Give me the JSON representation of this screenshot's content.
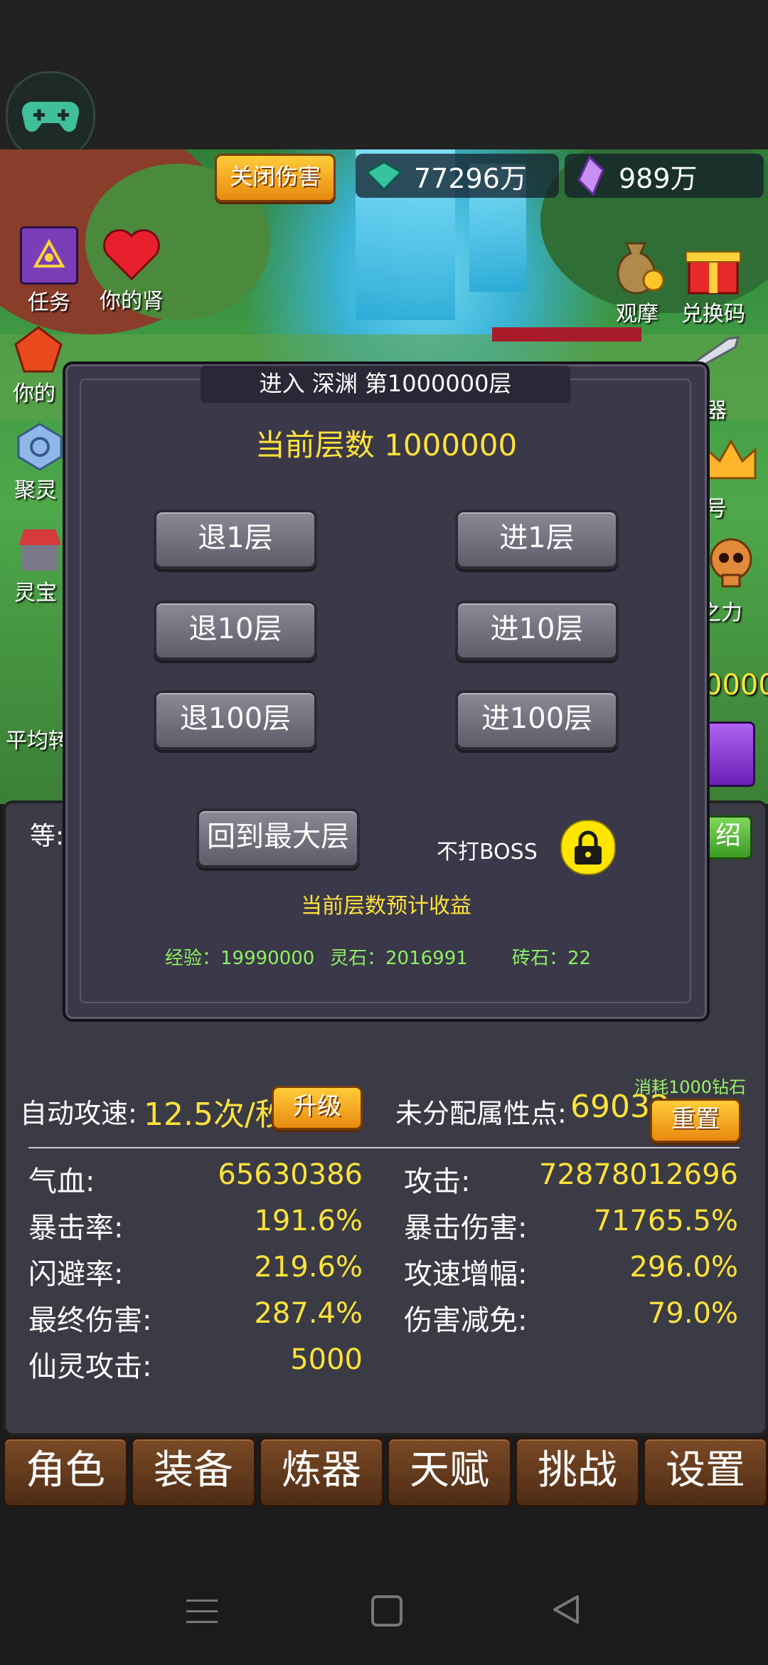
{
  "colors": {
    "accent_gold": "#ffe23a",
    "income_green": "#8ef060",
    "tab_brown": "#6b3e1e"
  },
  "top": {
    "close_damage_label": "关闭伤害",
    "gem_value": "77296万",
    "crystal_value": "989万"
  },
  "side_left": {
    "tasks_label": "任务",
    "your_kidney_label": "你的肾",
    "your_partial": "你的",
    "gather_partial": "聚灵",
    "treasure_partial": "灵宝",
    "avg_partial": "平均转",
    "level_partial": "等:"
  },
  "side_right": {
    "observe_label": "观摩",
    "redeem_label": "兑换码",
    "weapon_partial": "器",
    "title_partial": "号",
    "power_partial": "之力",
    "number_partial": "0000",
    "intro_partial": "绍"
  },
  "modal": {
    "title": "进入  深渊  第1000000层",
    "current_floor": "当前层数 1000000",
    "back1": "退1层",
    "forward1": "进1层",
    "back10": "退10层",
    "forward10": "进10层",
    "back100": "退100层",
    "forward100": "进100层",
    "return_max": "回到最大层",
    "no_boss": "不打BOSS",
    "income_title": "当前层数预计收益",
    "exp": "经验：19990000",
    "spirit_stone": "灵石：2016991",
    "brick": "砖石：22"
  },
  "stats": {
    "auto_speed_label": "自动攻速:",
    "auto_speed_value": "12.5次/秒",
    "upgrade_label": "升级",
    "unassigned_label": "未分配属性点:",
    "unassigned_value": "69032",
    "cost_note": "消耗1000钻石",
    "reset_label": "重置",
    "rows": [
      {
        "l1": "气血:",
        "v1": "65630386",
        "l2": "攻击:",
        "v2": "72878012696"
      },
      {
        "l1": "暴击率:",
        "v1": "191.6%",
        "l2": "暴击伤害:",
        "v2": "71765.5%"
      },
      {
        "l1": "闪避率:",
        "v1": "219.6%",
        "l2": "攻速增幅:",
        "v2": "296.0%"
      },
      {
        "l1": "最终伤害:",
        "v1": "287.4%",
        "l2": "伤害减免:",
        "v2": "79.0%"
      },
      {
        "l1": "仙灵攻击:",
        "v1": "5000",
        "l2": "",
        "v2": ""
      }
    ]
  },
  "tabs": [
    "角色",
    "装备",
    "炼器",
    "天赋",
    "挑战",
    "设置"
  ]
}
